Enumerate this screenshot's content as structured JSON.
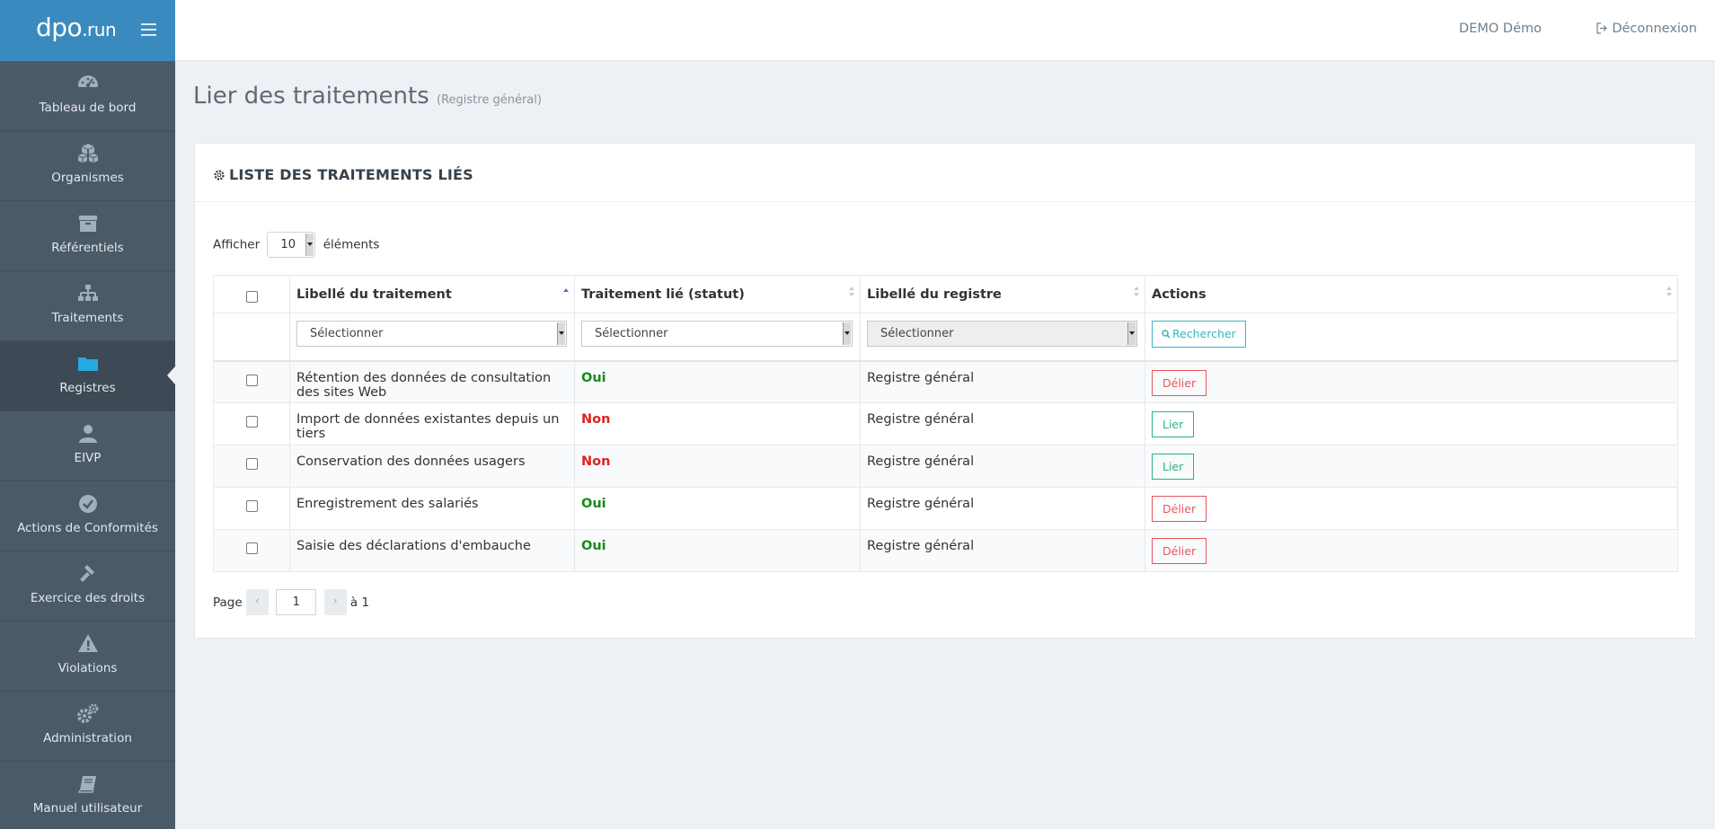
{
  "brand": {
    "logo_main": "dpo",
    "logo_suffix": ".run"
  },
  "sidebar": {
    "items": [
      {
        "label": "Tableau de bord",
        "icon": "dashboard-icon"
      },
      {
        "label": "Organismes",
        "icon": "cubes-icon"
      },
      {
        "label": "Référentiels",
        "icon": "archive-icon"
      },
      {
        "label": "Traitements",
        "icon": "sitemap-icon"
      },
      {
        "label": "Registres",
        "icon": "folder-icon",
        "active": true
      },
      {
        "label": "EIVP",
        "icon": "user-icon"
      },
      {
        "label": "Actions de Conformités",
        "icon": "check-circle-icon"
      },
      {
        "label": "Exercice des droits",
        "icon": "gavel-icon"
      },
      {
        "label": "Violations",
        "icon": "warning-icon"
      },
      {
        "label": "Administration",
        "icon": "gears-icon"
      },
      {
        "label": "Manuel utilisateur",
        "icon": "book-icon"
      }
    ]
  },
  "topbar": {
    "user": "DEMO Démo",
    "logout": "Déconnexion"
  },
  "page": {
    "title": "Lier des traitements",
    "subtitle": "(Registre général)"
  },
  "box": {
    "title": "LISTE DES TRAITEMENTS LIÉS"
  },
  "length": {
    "prefix": "Afficher",
    "value": "10",
    "suffix": "éléments"
  },
  "table": {
    "columns": [
      "Libellé du traitement",
      "Traitement lié (statut)",
      "Libellé du registre",
      "Actions"
    ],
    "filter_placeholder": "Sélectionner",
    "search_label": "Rechercher",
    "rows": [
      {
        "libelle": "Rétention des données de consultation des sites Web",
        "statut": "Oui",
        "registre": "Registre général",
        "action": "Délier"
      },
      {
        "libelle": "Import de données existantes depuis un tiers",
        "statut": "Non",
        "registre": "Registre général",
        "action": "Lier"
      },
      {
        "libelle": "Conservation des données usagers",
        "statut": "Non",
        "registre": "Registre général",
        "action": "Lier"
      },
      {
        "libelle": "Enregistrement des salariés",
        "statut": "Oui",
        "registre": "Registre général",
        "action": "Délier"
      },
      {
        "libelle": "Saisie des déclarations d'embauche",
        "statut": "Oui",
        "registre": "Registre général",
        "action": "Délier"
      }
    ]
  },
  "pager": {
    "label": "Page",
    "prev": "‹",
    "current": "1",
    "next": "›",
    "total": "à 1"
  },
  "colors": {
    "brand": "#3a8abf",
    "sidebar": "#4b5a67",
    "oui": "#1a8a1a",
    "non": "#e02020",
    "delier": "#e8555d",
    "lier": "#2db37a",
    "search": "#35b6c6"
  }
}
